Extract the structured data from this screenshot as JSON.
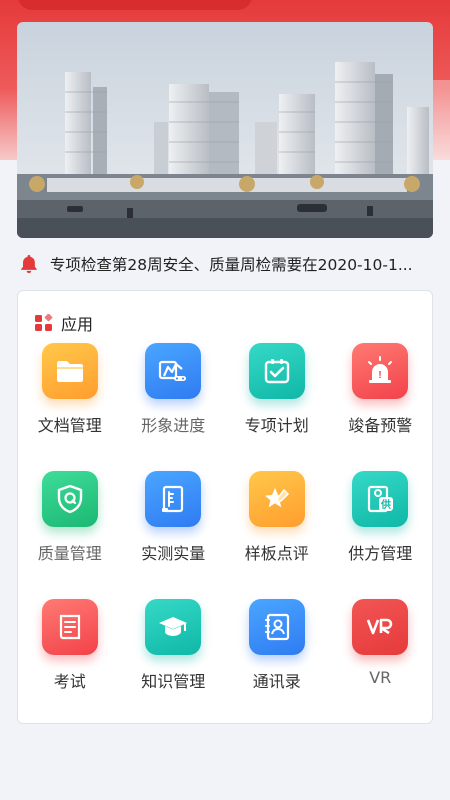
{
  "notice": {
    "icon": "bell-icon",
    "text": "专项检查第28周安全、质量周检需要在2020-10-1..."
  },
  "section": {
    "icon": "apps-grid-icon",
    "title": "应用"
  },
  "apps": [
    {
      "label": "文档管理",
      "icon": "folder-icon",
      "color_from": "#ffc84a",
      "color_to": "#ff9d2e",
      "muted": false
    },
    {
      "label": "形象进度",
      "icon": "excavator-icon",
      "color_from": "#4aa6ff",
      "color_to": "#2f7bf2",
      "muted": true
    },
    {
      "label": "专项计划",
      "icon": "checkbox-icon",
      "color_from": "#36d9c6",
      "color_to": "#10b7a7",
      "muted": false
    },
    {
      "label": "竣备预警",
      "icon": "alarm-light-icon",
      "color_from": "#ff7a72",
      "color_to": "#f2424a",
      "muted": false
    },
    {
      "label": "质量管理",
      "icon": "shield-q-icon",
      "color_from": "#3fdc9a",
      "color_to": "#1bb873",
      "muted": true
    },
    {
      "label": "实测实量",
      "icon": "ruler-scroll-icon",
      "color_from": "#4aa6ff",
      "color_to": "#2f7bf2",
      "muted": false
    },
    {
      "label": "样板点评",
      "icon": "star-pen-icon",
      "color_from": "#ffc84a",
      "color_to": "#ff9d2e",
      "muted": false
    },
    {
      "label": "供方管理",
      "icon": "supplier-icon",
      "color_from": "#36d9c6",
      "color_to": "#10b7a7",
      "muted": false
    },
    {
      "label": "考试",
      "icon": "exam-book-icon",
      "color_from": "#ff7a72",
      "color_to": "#f2424a",
      "muted": false
    },
    {
      "label": "知识管理",
      "icon": "graduation-cap-icon",
      "color_from": "#36d9c6",
      "color_to": "#10b7a7",
      "muted": false
    },
    {
      "label": "通讯录",
      "icon": "contacts-book-icon",
      "color_from": "#4aa6ff",
      "color_to": "#2f7bf2",
      "muted": false
    },
    {
      "label": "VR",
      "icon": "vr-icon",
      "color_from": "#f25555",
      "color_to": "#e63a3a",
      "muted": true
    }
  ],
  "colors": {
    "brand_red": "#e53a3a",
    "page_bg": "#f1f3f8"
  }
}
